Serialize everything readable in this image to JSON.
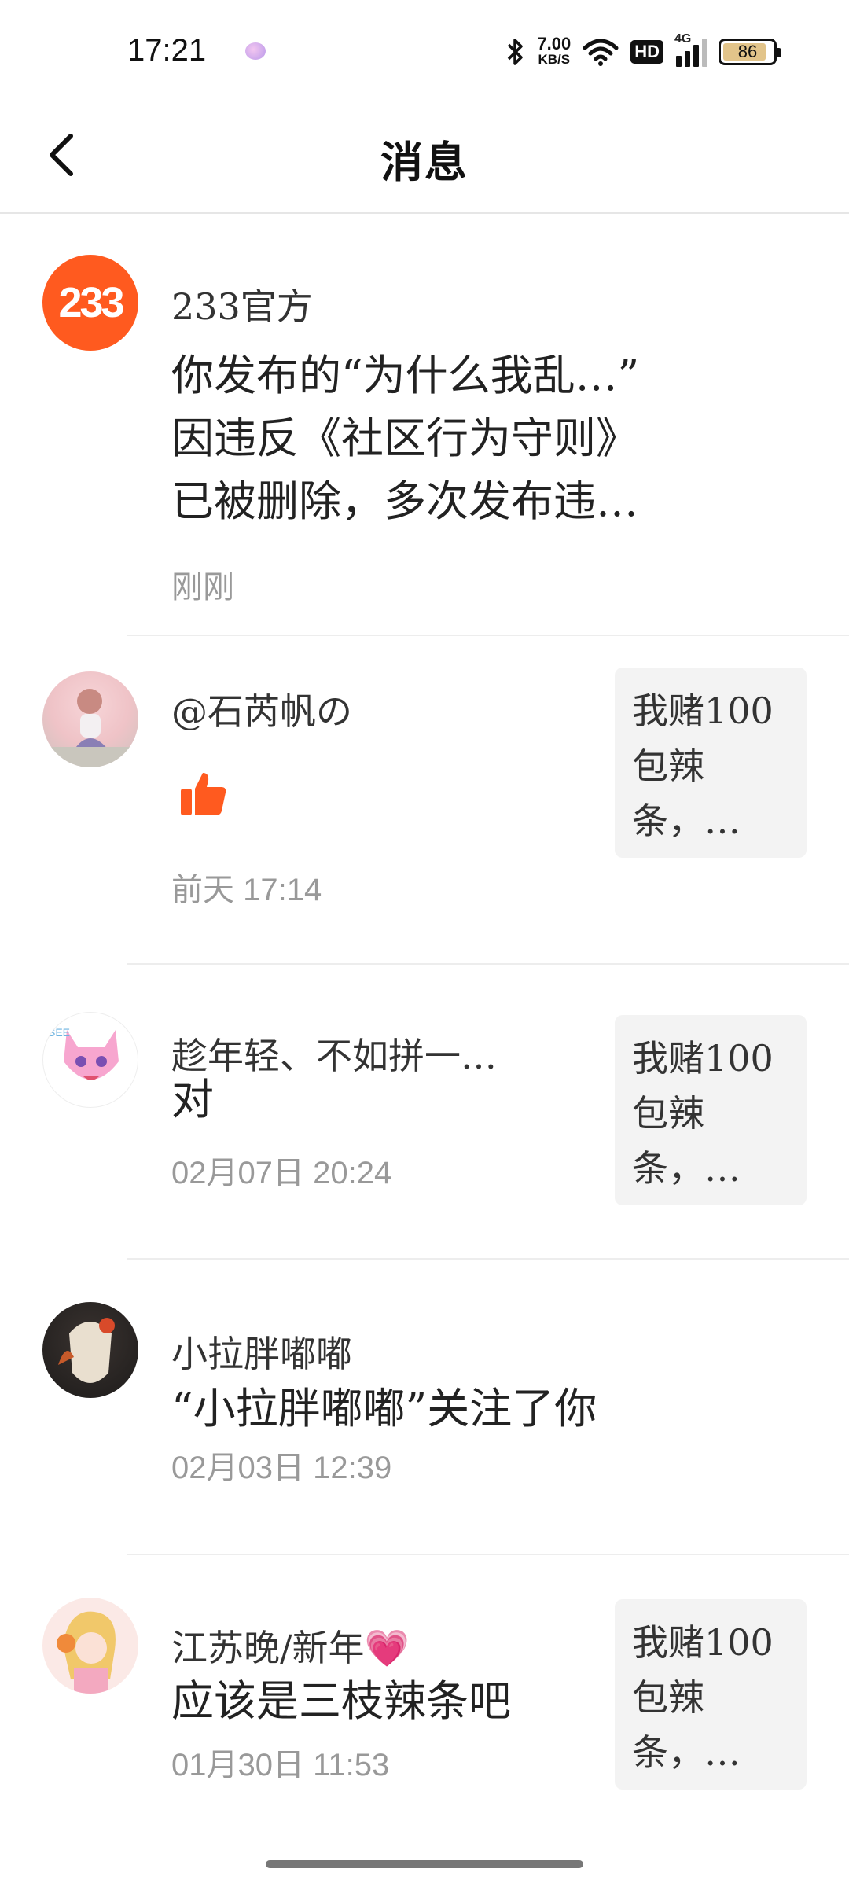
{
  "status_bar": {
    "time": "17:21",
    "net_speed_value": "7.00",
    "net_speed_unit": "KB/S",
    "hd": "HD",
    "network": "4G",
    "battery": "86"
  },
  "header": {
    "title": "消息"
  },
  "messages": [
    {
      "sender": "233官方",
      "avatar_text": "233",
      "content_lines": [
        "你发布的“为什么我乱…”",
        "因违反《社区行为守则》",
        "已被删除，多次发布违…"
      ],
      "time": "刚刚"
    },
    {
      "sender": "@石芮帆の",
      "content_icon": "thumbs-up-icon",
      "time": "前天  17:14",
      "ref_text": "我赌100包辣条，…"
    },
    {
      "sender": "趁年轻、不如拼一…",
      "content": "对",
      "time": "02月07日  20:24",
      "ref_text": "我赌100包辣条，…"
    },
    {
      "sender": "小拉胖嘟嘟",
      "content": "“小拉胖嘟嘟”关注了你",
      "time": "02月03日  12:39"
    },
    {
      "sender": "江苏晚/新年💗",
      "content": "应该是三枝辣条吧",
      "time": "01月30日  11:53",
      "ref_text": "我赌100包辣条，…"
    }
  ],
  "colors": {
    "accent_orange": "#ff5a1f",
    "time_gray": "#999999",
    "ref_bg": "#f3f3f3"
  }
}
